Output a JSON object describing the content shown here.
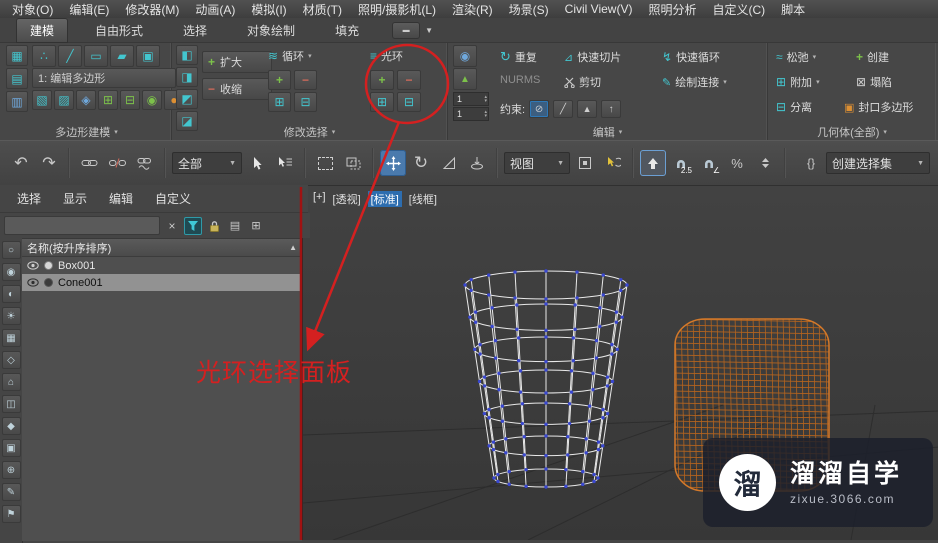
{
  "menubar": {
    "items": [
      "对象(O)",
      "编辑(E)",
      "修改器(M)",
      "动画(A)",
      "模拟(I)",
      "材质(T)",
      "照明/摄影机(L)",
      "渲染(R)",
      "场景(S)",
      "Civil View(V)",
      "照明分析",
      "自定义(C)",
      "脚本"
    ]
  },
  "ribbon": {
    "tabs": [
      "建模",
      "自由形式",
      "选择",
      "对象绘制",
      "填充"
    ],
    "active_tab": "建模",
    "polygon_modeling": {
      "title": "多边形建模",
      "edit_mode": "1: 编辑多边形"
    },
    "modify_selection": {
      "title": "修改选择",
      "grow": "扩大",
      "shrink": "收缩",
      "loop": "循环",
      "ring": "光环"
    },
    "edit": {
      "title": "编辑",
      "repeat": "重复",
      "nurms": "NURMS",
      "quick_slice": "快速切片",
      "cut": "剪切",
      "swift_loop": "快速循环",
      "paint_connect": "绘制连接",
      "constraints": "约束:",
      "msmooth_value": "1",
      "tessellate_value": "1"
    },
    "geometry": {
      "title": "几何体(全部)",
      "relax": "松弛",
      "create": "创建",
      "attach": "附加",
      "collapse": "塌陷",
      "detach": "分离",
      "cap": "封口多边形"
    }
  },
  "toolbar": {
    "selection_filter": "全部",
    "reference_coordsys": "视图",
    "named_sets": "创建选择集",
    "snap_value": "2.5",
    "percent_symbol": "%"
  },
  "explorer": {
    "menu": [
      "选择",
      "显示",
      "编辑",
      "自定义"
    ],
    "search_value": "",
    "sort_header": "名称(按升序排序)",
    "rows": [
      {
        "name": "Box001",
        "selected": false
      },
      {
        "name": "Cone001",
        "selected": true
      }
    ]
  },
  "viewport": {
    "labels": {
      "menu": "[+]",
      "pov": "[透视]",
      "standard": "[标准]",
      "shading": "[线框]"
    }
  },
  "annotation": {
    "label": "光环选择面板",
    "color": "#d42020"
  },
  "watermark": {
    "brand": "溜溜自学",
    "site": "zixue.3066.com",
    "logo": "溜"
  },
  "colors": {
    "accent_red": "#d42020",
    "orange_object": "#c8702a",
    "selection_blue": "#4a7aad",
    "vertex_blue": "#3947d0"
  },
  "icons": {
    "undo": "↶",
    "redo": "↷",
    "dropdown": "▼",
    "small_down": "▾",
    "sort_asc": "▲",
    "close": "×",
    "minimize": "▬",
    "plus": "+",
    "minus": "−",
    "spin_up": "▴",
    "spin_down": "▾",
    "vertex": "∴",
    "edge": "╱",
    "border": "▭",
    "polygon": "▰",
    "element": "▣",
    "pm_a": "▦",
    "pm_b": "▤",
    "pm_c": "▥",
    "pm_1": "▧",
    "pm_2": "▨",
    "pm_3": "◈",
    "pm_4": "⊞",
    "pm_5": "⊟",
    "pm_6": "◉",
    "pm_7": "●",
    "conv_a": "◧",
    "conv_b": "◨",
    "conv_c": "◩",
    "conv_d": "◪",
    "loop": "≋",
    "ring": "≡",
    "bars_plus": "⊞",
    "bars_minus": "⊟",
    "repeat": "↻",
    "quick_slice": "⊿",
    "swift_loop": "↯",
    "paint_connect": "✎",
    "msmooth": "◉",
    "tessellate": "▲",
    "c_none": "⊘",
    "c_edge": "╱",
    "c_face": "▲",
    "c_normal": "↑",
    "relax": "≈",
    "create": "+",
    "attach": "⊞",
    "collapse": "⊠",
    "detach": "⊟",
    "cap": "▣",
    "rotate": "↻",
    "angle": "∠",
    "braces": "{}",
    "list": "▤",
    "columns": "⊞",
    "explorer_tools": [
      "○",
      "◉",
      "◐",
      "☀",
      "▦",
      "◇",
      "⌂",
      "◫",
      "◆",
      "▣",
      "⊕",
      "✎",
      "⚑"
    ]
  }
}
